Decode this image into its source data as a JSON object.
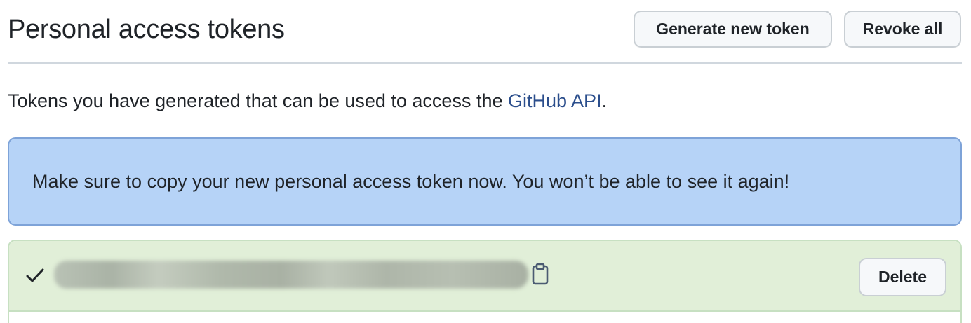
{
  "header": {
    "title": "Personal access tokens",
    "generate_label": "Generate new token",
    "revoke_label": "Revoke all"
  },
  "intro": {
    "text_before": "Tokens you have generated that can be used to access the ",
    "link_text": "GitHub API",
    "text_after": "."
  },
  "flash": {
    "message": "Make sure to copy your new personal access token now. You won’t be able to see it again!"
  },
  "token": {
    "value": "",
    "delete_label": "Delete"
  },
  "icons": {
    "check": "check-icon",
    "copy": "clipboard-copy-icon"
  },
  "colors": {
    "link": "#2b4e8c",
    "flash_background": "#b6d3f7",
    "flash_border": "#7ea3d8",
    "token_row_background": "#e1efd8",
    "token_border": "#c7e0c2",
    "button_background": "#f6f8fa"
  }
}
